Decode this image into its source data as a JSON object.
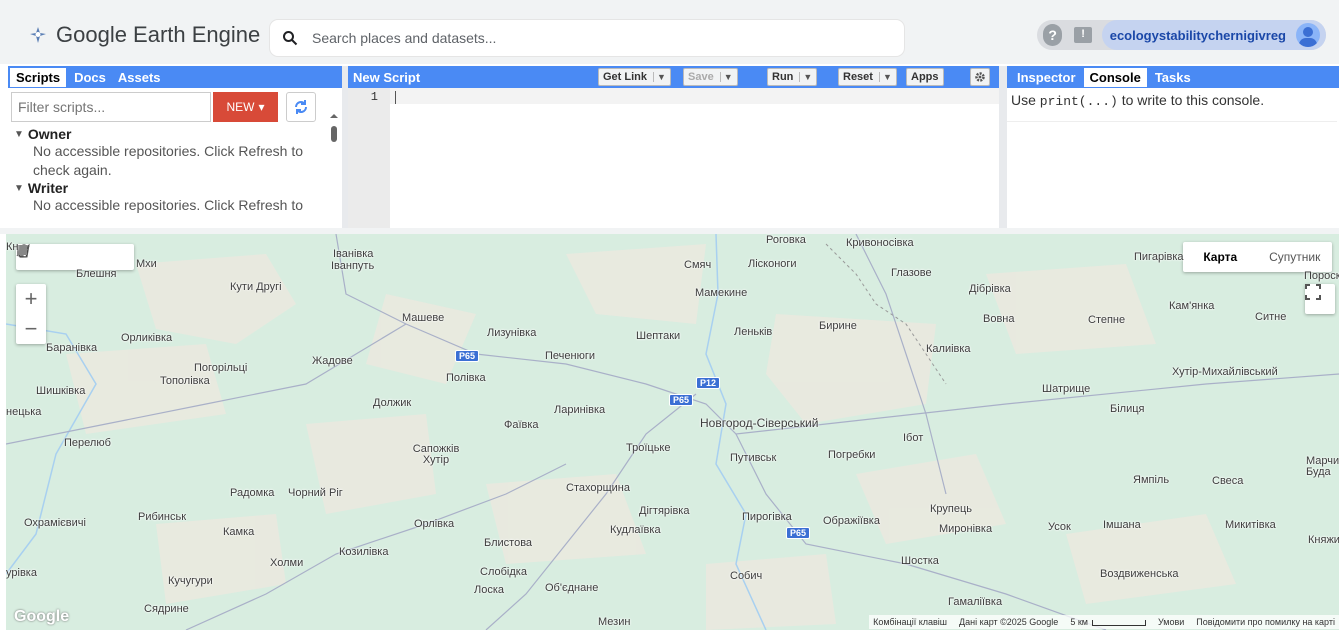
{
  "header": {
    "product_name": "Google Earth Engine",
    "search_placeholder": "Search places and datasets...",
    "help_icon": "question-icon",
    "feedback_icon": "feedback-icon",
    "username": "ecologystabilitychernigivreg"
  },
  "left_panel": {
    "tabs": [
      "Scripts",
      "Docs",
      "Assets"
    ],
    "active_tab": "Scripts",
    "filter_placeholder": "Filter scripts...",
    "new_button": "NEW",
    "tree": [
      {
        "label": "Owner",
        "message": "No accessible repositories. Click Refresh to check again."
      },
      {
        "label": "Writer",
        "message": "No accessible repositories. Click Refresh to check again."
      }
    ]
  },
  "editor": {
    "title": "New Script",
    "buttons": {
      "get_link": "Get Link",
      "save": "Save",
      "run": "Run",
      "reset": "Reset",
      "apps": "Apps"
    },
    "line_number": "1"
  },
  "right_panel": {
    "tabs": [
      "Inspector",
      "Console",
      "Tasks"
    ],
    "active_tab": "Console",
    "console_prefix": "Use ",
    "console_code": "print(...)",
    "console_suffix": " to write to this console."
  },
  "map": {
    "map_type": {
      "map": "Карта",
      "satellite": "Супутник"
    },
    "zoom_in": "+",
    "zoom_out": "−",
    "watermark": "Google",
    "footer": {
      "shortcuts": "Комбінації клавіш",
      "data": "Дані карт ©2025 Google",
      "scale": "5 км",
      "terms": "Умови",
      "report": "Повідомити про помилку на карті"
    },
    "places": {
      "p01": "Мхи",
      "p02": "Блешня",
      "p03": "Кути Другі",
      "p04": "Іванівка",
      "p05": "Іванпуть",
      "p06": "Орликівка",
      "p07": "Баранівка",
      "p08": "Погорільці",
      "p09": "Тополівка",
      "p10": "Жадове",
      "p11": "Шишківка",
      "p12": "нецька",
      "p13": "Перелюб",
      "p14": "Машеве",
      "p15": "Лизунівка",
      "p16": "Печенюги",
      "p17": "Полівка",
      "p18": "Должик",
      "p19": "Фаївка",
      "p20": "Ларинівка",
      "p21": "Сапожків Хутір",
      "p22": "Радомка",
      "p23": "Чорний Ріг",
      "p24": "Рибинськ",
      "p25": "Охрамієвичі",
      "p26": "Камка",
      "p27": "Орлівка",
      "p28": "Козилівка",
      "p29": "Холми",
      "p30": "Кучугури",
      "p31": "урівка",
      "p32": "Сядрине",
      "p33": "Роговка",
      "p34": "Кривоносівка",
      "p35": "Смяч",
      "p36": "Лісконоги",
      "p37": "Глазове",
      "p38": "Мамекине",
      "p39": "Дібрівка",
      "p40": "Шептаки",
      "p41": "Леньків",
      "p42": "Бирине",
      "p43": "Вовна",
      "p44": "Степне",
      "p45": "Кам'янка",
      "p46": "Ситне",
      "p47": "Пигарівка",
      "p48": "Пороск",
      "p49": "Калиівка",
      "p50": "Хутір-Михайлівський",
      "p51": "Шатрище",
      "p52": "Білиця",
      "p53": "Новгород-Сіверський",
      "p54": "Троїцьке",
      "p55": "Ібот",
      "p56": "Погребки",
      "p57": "Стахорщина",
      "p58": "Путивськ",
      "p59": "Дігтярівка",
      "p60": "Кудлаївка",
      "p61": "Пирогівка",
      "p62": "Ображіївка",
      "p63": "Крупець",
      "p64": "Миронівка",
      "p65": "Усок",
      "p66": "Імшана",
      "p67": "Микитівка",
      "p68": "Ямпіль",
      "p69": "Свеса",
      "p70": "Марчихи Буда",
      "p71": "Блистова",
      "p72": "Слобідка",
      "p73": "Лоска",
      "p74": "Об'єднане",
      "p75": "Собич",
      "p76": "Шостка",
      "p77": "Воздвиженська",
      "p78": "Гамаліївка",
      "p79": "Мезин",
      "p80": "Княжи",
      "p81": "Кн"
    },
    "shields": {
      "s1": "P65",
      "s2": "P12",
      "s3": "P65",
      "s4": "P65"
    }
  }
}
